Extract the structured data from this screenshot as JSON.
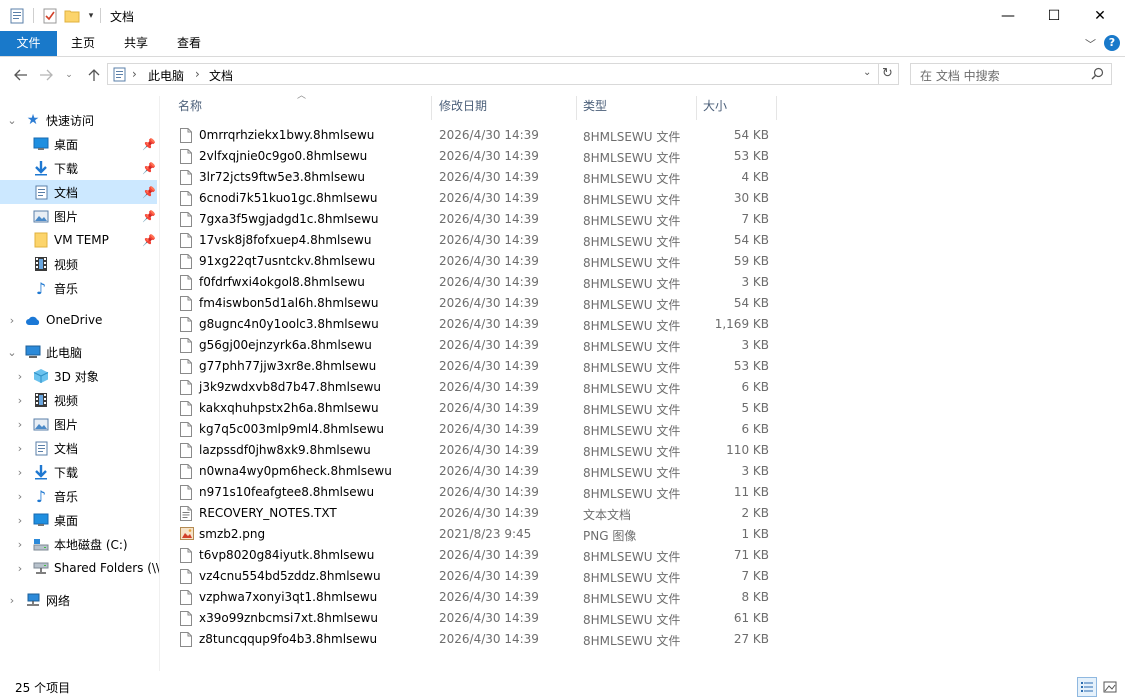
{
  "window": {
    "title": "文档",
    "controls": {
      "minimize": "—",
      "maximize": "☐",
      "close": "✕"
    }
  },
  "ribbon": {
    "tabs": [
      "文件",
      "主页",
      "共享",
      "查看"
    ]
  },
  "address": {
    "segments": [
      "此电脑",
      "文档"
    ],
    "search_placeholder": "在 文档 中搜索"
  },
  "nav": {
    "quick_access": {
      "label": "快速访问",
      "items": [
        {
          "label": "桌面",
          "icon": "desktop-icon",
          "pinned": true
        },
        {
          "label": "下载",
          "icon": "download-icon",
          "pinned": true
        },
        {
          "label": "文档",
          "icon": "document-icon",
          "pinned": true,
          "selected": true
        },
        {
          "label": "图片",
          "icon": "pictures-icon",
          "pinned": true
        },
        {
          "label": "VM TEMP",
          "icon": "folder-icon",
          "pinned": true
        },
        {
          "label": "视频",
          "icon": "video-icon",
          "pinned": false
        },
        {
          "label": "音乐",
          "icon": "music-icon",
          "pinned": false
        }
      ]
    },
    "onedrive": "OneDrive",
    "this_pc": {
      "label": "此电脑",
      "items": [
        {
          "label": "3D 对象",
          "icon": "3d-objects-icon"
        },
        {
          "label": "视频",
          "icon": "video-icon"
        },
        {
          "label": "图片",
          "icon": "pictures-icon"
        },
        {
          "label": "文档",
          "icon": "document-icon"
        },
        {
          "label": "下载",
          "icon": "download-icon"
        },
        {
          "label": "音乐",
          "icon": "music-icon"
        },
        {
          "label": "桌面",
          "icon": "desktop-icon"
        },
        {
          "label": "本地磁盘 (C:)",
          "icon": "drive-icon"
        },
        {
          "label": "Shared Folders (\\\\",
          "icon": "network-drive-icon"
        }
      ]
    },
    "network": "网络"
  },
  "columns": [
    "名称",
    "修改日期",
    "类型",
    "大小"
  ],
  "files": [
    {
      "name": "0mrrqrhziekx1bwy.8hmlsewu",
      "date": "2026/4/30 14:39",
      "type": "8HMLSEWU 文件",
      "size": "54 KB",
      "icon": "file-icon"
    },
    {
      "name": "2vlfxqjnie0c9go0.8hmlsewu",
      "date": "2026/4/30 14:39",
      "type": "8HMLSEWU 文件",
      "size": "53 KB",
      "icon": "file-icon"
    },
    {
      "name": "3lr72jcts9ftw5e3.8hmlsewu",
      "date": "2026/4/30 14:39",
      "type": "8HMLSEWU 文件",
      "size": "4 KB",
      "icon": "file-icon"
    },
    {
      "name": "6cnodi7k51kuo1gc.8hmlsewu",
      "date": "2026/4/30 14:39",
      "type": "8HMLSEWU 文件",
      "size": "30 KB",
      "icon": "file-icon"
    },
    {
      "name": "7gxa3f5wgjadgd1c.8hmlsewu",
      "date": "2026/4/30 14:39",
      "type": "8HMLSEWU 文件",
      "size": "7 KB",
      "icon": "file-icon"
    },
    {
      "name": "17vsk8j8fofxuep4.8hmlsewu",
      "date": "2026/4/30 14:39",
      "type": "8HMLSEWU 文件",
      "size": "54 KB",
      "icon": "file-icon"
    },
    {
      "name": "91xg22qt7usntckv.8hmlsewu",
      "date": "2026/4/30 14:39",
      "type": "8HMLSEWU 文件",
      "size": "59 KB",
      "icon": "file-icon"
    },
    {
      "name": "f0fdrfwxi4okgol8.8hmlsewu",
      "date": "2026/4/30 14:39",
      "type": "8HMLSEWU 文件",
      "size": "3 KB",
      "icon": "file-icon"
    },
    {
      "name": "fm4iswbon5d1al6h.8hmlsewu",
      "date": "2026/4/30 14:39",
      "type": "8HMLSEWU 文件",
      "size": "54 KB",
      "icon": "file-icon"
    },
    {
      "name": "g8ugnc4n0y1oolc3.8hmlsewu",
      "date": "2026/4/30 14:39",
      "type": "8HMLSEWU 文件",
      "size": "1,169 KB",
      "icon": "file-icon"
    },
    {
      "name": "g56gj00ejnzyrk6a.8hmlsewu",
      "date": "2026/4/30 14:39",
      "type": "8HMLSEWU 文件",
      "size": "3 KB",
      "icon": "file-icon"
    },
    {
      "name": "g77phh77jjw3xr8e.8hmlsewu",
      "date": "2026/4/30 14:39",
      "type": "8HMLSEWU 文件",
      "size": "53 KB",
      "icon": "file-icon"
    },
    {
      "name": "j3k9zwdxvb8d7b47.8hmlsewu",
      "date": "2026/4/30 14:39",
      "type": "8HMLSEWU 文件",
      "size": "6 KB",
      "icon": "file-icon"
    },
    {
      "name": "kakxqhuhpstx2h6a.8hmlsewu",
      "date": "2026/4/30 14:39",
      "type": "8HMLSEWU 文件",
      "size": "5 KB",
      "icon": "file-icon"
    },
    {
      "name": "kg7q5c003mlp9ml4.8hmlsewu",
      "date": "2026/4/30 14:39",
      "type": "8HMLSEWU 文件",
      "size": "6 KB",
      "icon": "file-icon"
    },
    {
      "name": "lazpssdf0jhw8xk9.8hmlsewu",
      "date": "2026/4/30 14:39",
      "type": "8HMLSEWU 文件",
      "size": "110 KB",
      "icon": "file-icon"
    },
    {
      "name": "n0wna4wy0pm6heck.8hmlsewu",
      "date": "2026/4/30 14:39",
      "type": "8HMLSEWU 文件",
      "size": "3 KB",
      "icon": "file-icon"
    },
    {
      "name": "n971s10feafgtee8.8hmlsewu",
      "date": "2026/4/30 14:39",
      "type": "8HMLSEWU 文件",
      "size": "11 KB",
      "icon": "file-icon"
    },
    {
      "name": "RECOVERY_NOTES.TXT",
      "date": "2026/4/30 14:39",
      "type": "文本文档",
      "size": "2 KB",
      "icon": "text-file-icon"
    },
    {
      "name": "smzb2.png",
      "date": "2021/8/23 9:45",
      "type": "PNG 图像",
      "size": "1 KB",
      "icon": "image-file-icon"
    },
    {
      "name": "t6vp8020g84iyutk.8hmlsewu",
      "date": "2026/4/30 14:39",
      "type": "8HMLSEWU 文件",
      "size": "71 KB",
      "icon": "file-icon"
    },
    {
      "name": "vz4cnu554bd5zddz.8hmlsewu",
      "date": "2026/4/30 14:39",
      "type": "8HMLSEWU 文件",
      "size": "7 KB",
      "icon": "file-icon"
    },
    {
      "name": "vzphwa7xonyi3qt1.8hmlsewu",
      "date": "2026/4/30 14:39",
      "type": "8HMLSEWU 文件",
      "size": "8 KB",
      "icon": "file-icon"
    },
    {
      "name": "x39o99znbcmsi7xt.8hmlsewu",
      "date": "2026/4/30 14:39",
      "type": "8HMLSEWU 文件",
      "size": "61 KB",
      "icon": "file-icon"
    },
    {
      "name": "z8tuncqqup9fo4b3.8hmlsewu",
      "date": "2026/4/30 14:39",
      "type": "8HMLSEWU 文件",
      "size": "27 KB",
      "icon": "file-icon"
    }
  ],
  "status": {
    "item_count": "25 个项目"
  },
  "colors": {
    "accent": "#1979ca",
    "selection": "#cce8ff",
    "header_text": "#4c607a"
  }
}
